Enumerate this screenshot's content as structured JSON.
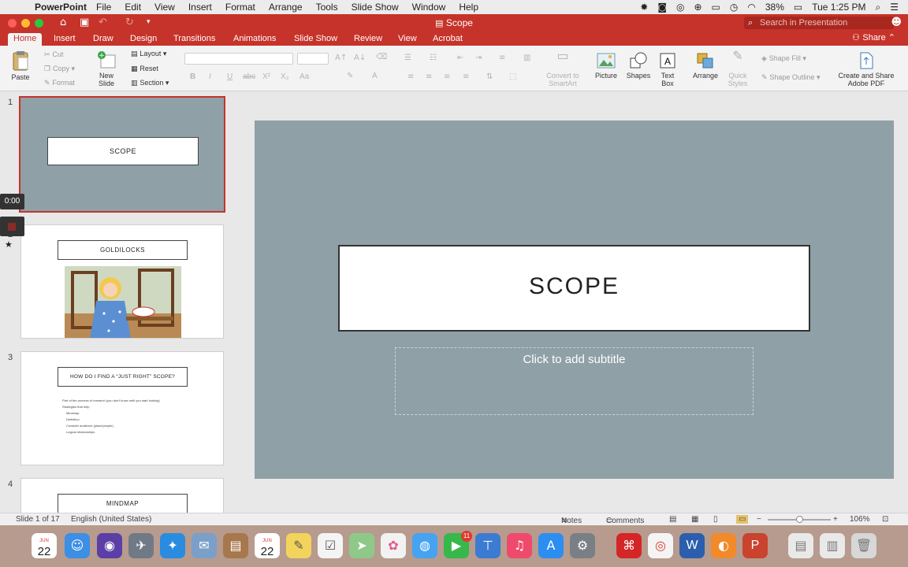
{
  "menubar": {
    "app_name": "PowerPoint",
    "items": [
      "File",
      "Edit",
      "View",
      "Insert",
      "Format",
      "Arrange",
      "Tools",
      "Slide Show",
      "Window",
      "Help"
    ],
    "battery": "38%",
    "clock": "Tue 1:25 PM"
  },
  "window": {
    "title": "Scope",
    "search_placeholder": "Search in Presentation",
    "share_label": "Share"
  },
  "ribbon_tabs": [
    "Home",
    "Insert",
    "Draw",
    "Design",
    "Transitions",
    "Animations",
    "Slide Show",
    "Review",
    "View",
    "Acrobat"
  ],
  "ribbon": {
    "paste": "Paste",
    "cut": "Cut",
    "copy": "Copy",
    "format": "Format",
    "new_slide": "New Slide",
    "layout": "Layout",
    "reset": "Reset",
    "section": "Section",
    "convert_smartart": "Convert to SmartArt",
    "picture": "Picture",
    "shapes": "Shapes",
    "text_box": "Text Box",
    "arrange": "Arrange",
    "quick_styles": "Quick Styles",
    "shape_fill": "Shape Fill",
    "shape_outline": "Shape Outline",
    "create_pdf": "Create and Share Adobe PDF"
  },
  "recording": {
    "timer": "0:00"
  },
  "thumbnails": [
    {
      "number": "1",
      "title": "SCOPE"
    },
    {
      "number": "2",
      "title": "GOLDILOCKS"
    },
    {
      "number": "3",
      "title": "HOW DO I FIND A “JUST RIGHT” SCOPE?",
      "bullets": [
        "Part of the process of research (you don't know until you start looking)",
        "Strategies that help",
        "Mindmap",
        "Definition",
        "Consider audience (place/people)",
        "Logical relationships"
      ]
    },
    {
      "number": "4",
      "title": "MINDMAP"
    }
  ],
  "slide": {
    "title": "SCOPE",
    "subtitle_placeholder": "Click to add subtitle"
  },
  "statusbar": {
    "slide_info": "Slide 1 of 17",
    "language": "English (United States)",
    "notes": "Notes",
    "comments": "Comments",
    "zoom": "106%"
  },
  "dock": {
    "calendar_date": "22",
    "calendar_month": "JUN",
    "messages_badge": "11"
  },
  "colors": {
    "accent": "#c6332a",
    "slide_background": "#8fa0a7"
  }
}
